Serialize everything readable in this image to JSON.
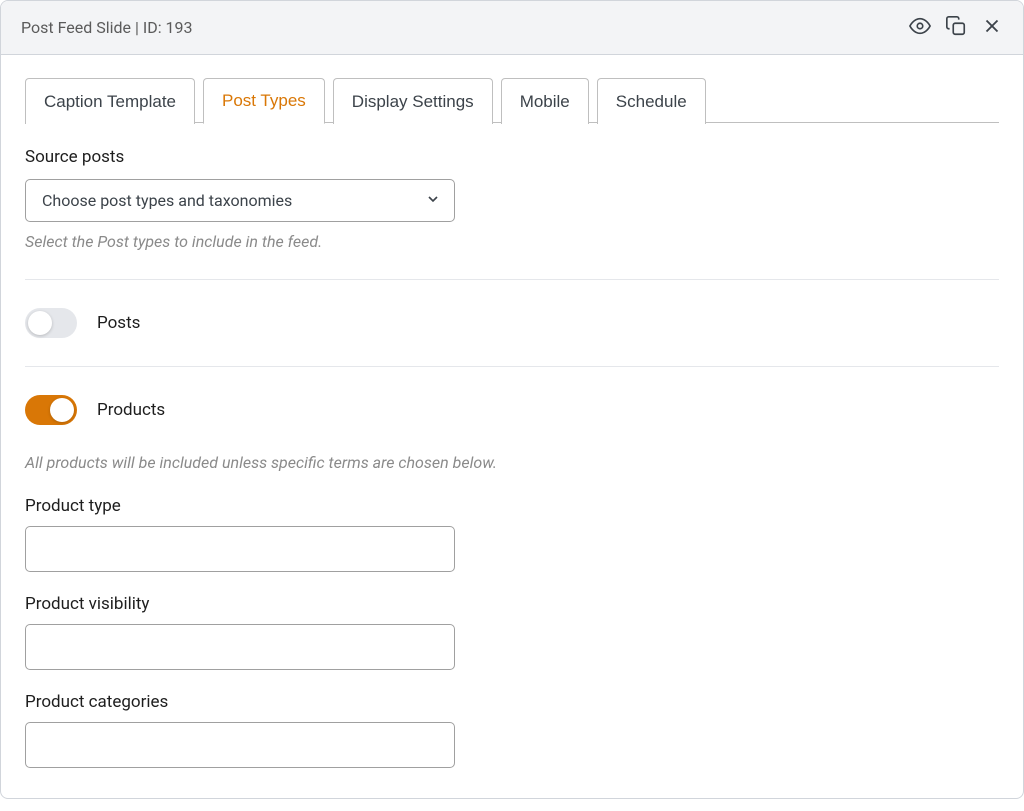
{
  "header": {
    "title": "Post Feed Slide | ID: 193"
  },
  "tabs": [
    {
      "label": "Caption Template",
      "active": false
    },
    {
      "label": "Post Types",
      "active": true
    },
    {
      "label": "Display Settings",
      "active": false
    },
    {
      "label": "Mobile",
      "active": false
    },
    {
      "label": "Schedule",
      "active": false
    }
  ],
  "sourcePosts": {
    "label": "Source posts",
    "selected": "Choose post types and taxonomies",
    "hint": "Select the Post types to include in the feed."
  },
  "toggles": {
    "posts": {
      "label": "Posts",
      "on": false
    },
    "products": {
      "label": "Products",
      "on": true
    }
  },
  "productsHint": "All products will be included unless specific terms are chosen below.",
  "productFields": {
    "type": {
      "label": "Product type",
      "value": ""
    },
    "visibility": {
      "label": "Product visibility",
      "value": ""
    },
    "categories": {
      "label": "Product categories",
      "value": ""
    }
  }
}
